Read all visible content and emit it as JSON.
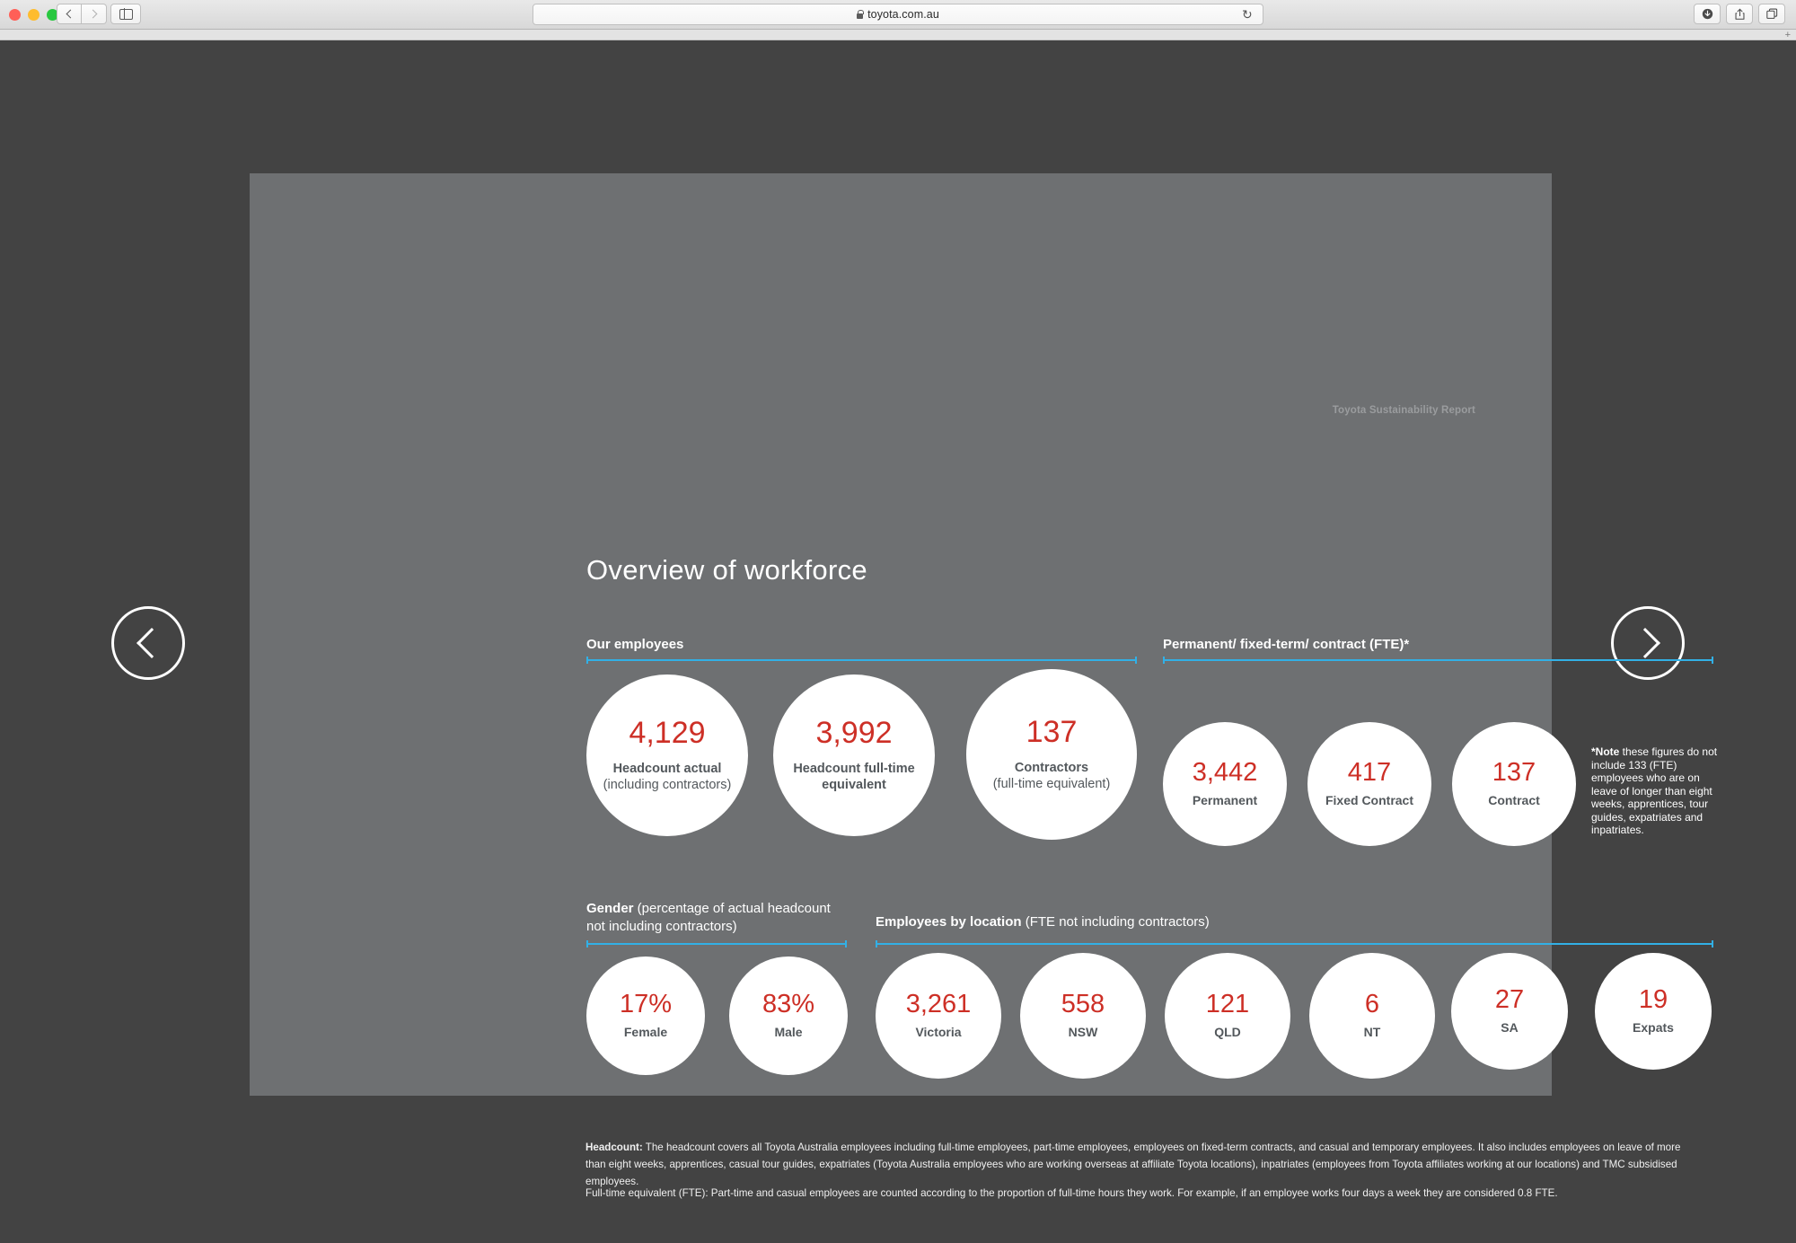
{
  "browser": {
    "url": "toyota.com.au",
    "lock_icon": "lock-icon",
    "back_icon": "chevron-left-icon",
    "forward_icon": "chevron-right-icon",
    "sidebar_icon": "sidebar-toggle-icon",
    "reload_icon": "reload-icon",
    "downloads_icon": "downloads-icon",
    "share_icon": "share-icon",
    "tabs_icon": "show-all-tabs-icon",
    "new_tab_icon": "new-tab-plus-icon"
  },
  "viewer": {
    "prev_icon": "chevron-left-icon",
    "next_icon": "chevron-right-icon",
    "prev_label": "Previous slide",
    "next_label": "Next slide"
  },
  "slide": {
    "report_label": "Toyota Sustainability Report",
    "title": "Overview of workforce",
    "accent_color": "#32b0e6",
    "number_color": "#cd2f26",
    "label_color": "#53585c",
    "background_color": "#6e7072"
  },
  "sections": {
    "employees": {
      "heading_bold": "Our employees",
      "heading_rest": ""
    },
    "contract": {
      "heading_bold": "Permanent/ fixed-term/ contract (FTE)*",
      "heading_rest": ""
    },
    "gender": {
      "heading_bold": "Gender",
      "heading_rest": " (percentage of actual headcount not including contractors)"
    },
    "location": {
      "heading_bold": "Employees by location",
      "heading_rest": " (FTE not including contractors)"
    }
  },
  "note": {
    "bold": "*Note",
    "text": " these figures do not include 133 (FTE) employees who are on leave of longer than eight weeks, apprentices, tour guides, expatriates and inpatriates."
  },
  "footnotes": [
    {
      "bold": "Headcount:",
      "text": " The headcount covers all Toyota Australia employees including full-time employees, part-time employees, employees on fixed-term contracts, and casual and temporary employees. It also includes employees on leave of more than eight weeks, apprentices, casual tour guides, expatriates (Toyota Australia employees who are working overseas at affiliate Toyota locations), inpatriates (employees from Toyota affiliates working at our locations) and TMC subsidised employees."
    },
    {
      "bold": "",
      "text": "Full-time equivalent (FTE): Part-time and casual employees are counted according to the proportion of full-time hours they work. For example, if an employee works four days a week they are considered 0.8 FTE."
    }
  ],
  "chart_data": {
    "type": "bubble",
    "title": "Overview of workforce",
    "groups": [
      {
        "name": "Our employees",
        "items": [
          {
            "value": "4,129",
            "label_bold": "Headcount actual",
            "label_reg": "(including contractors)"
          },
          {
            "value": "3,992",
            "label_bold": "Headcount full-time equivalent",
            "label_reg": ""
          },
          {
            "value": "137",
            "label_bold": "Contractors",
            "label_reg": "(full-time equivalent)"
          }
        ]
      },
      {
        "name": "Permanent/ fixed-term/ contract (FTE)*",
        "items": [
          {
            "value": "3,442",
            "label_bold": "Permanent",
            "label_reg": ""
          },
          {
            "value": "417",
            "label_bold": "Fixed Contract",
            "label_reg": ""
          },
          {
            "value": "137",
            "label_bold": "Contract",
            "label_reg": ""
          }
        ]
      },
      {
        "name": "Gender (percentage of actual headcount not including contractors)",
        "items": [
          {
            "value": "17%",
            "label_bold": "Female",
            "label_reg": ""
          },
          {
            "value": "83%",
            "label_bold": "Male",
            "label_reg": ""
          }
        ]
      },
      {
        "name": "Employees by location (FTE not including contractors)",
        "items": [
          {
            "value": "3,261",
            "label_bold": "Victoria",
            "label_reg": ""
          },
          {
            "value": "558",
            "label_bold": "NSW",
            "label_reg": ""
          },
          {
            "value": "121",
            "label_bold": "QLD",
            "label_reg": ""
          },
          {
            "value": "6",
            "label_bold": "NT",
            "label_reg": ""
          },
          {
            "value": "27",
            "label_bold": "SA",
            "label_reg": ""
          },
          {
            "value": "19",
            "label_bold": "Expats",
            "label_reg": ""
          }
        ]
      }
    ]
  }
}
